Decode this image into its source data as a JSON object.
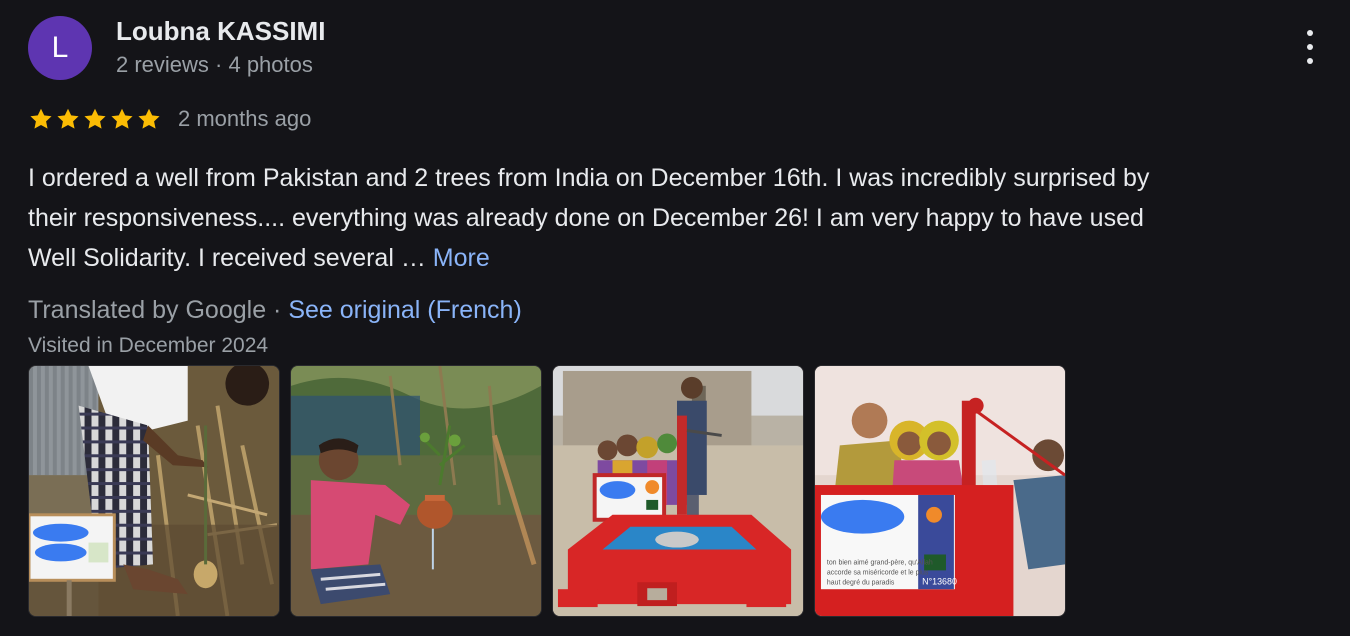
{
  "reviewer": {
    "initial": "L",
    "name": "Loubna KASSIMI",
    "meta": "2 reviews · 4 photos",
    "avatar_color": "#5e35b1"
  },
  "rating": {
    "stars": 5,
    "star_color": "#fbbc04",
    "date": "2 months ago"
  },
  "review": {
    "line1": "I ordered a well from Pakistan and 2 trees from India on December 16th. I was incredibly surprised by",
    "line2": "their responsiveness.... everything was already done on December 26!  I am very happy to have used",
    "line3": "Well Solidarity.  I received several … ",
    "more_label": "More"
  },
  "translation": {
    "label": "Translated by Google · ",
    "see_original": "See original (French)"
  },
  "visited": "Visited in December 2024",
  "photos": [
    {
      "name": "photo-tree-planting-1",
      "plaque_text": ""
    },
    {
      "name": "photo-tree-planting-2",
      "plaque_text": ""
    },
    {
      "name": "photo-well-children-1",
      "plaque_text": ""
    },
    {
      "name": "photo-well-children-2",
      "plaque_text": "N°13680"
    }
  ],
  "icons": {
    "more_menu": "more-vert-icon",
    "star": "star-icon"
  },
  "colors": {
    "background": "#141418",
    "text_primary": "#e8eaed",
    "text_secondary": "#9aa0a6",
    "link": "#8ab4f8"
  }
}
